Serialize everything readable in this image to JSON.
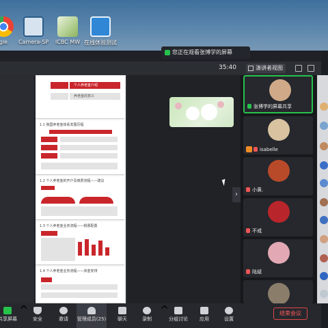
{
  "desktop": {
    "icons": [
      {
        "label": "gle",
        "icon": "chrome-icon",
        "color": "#d9d9d9"
      },
      {
        "label": "Camera-SP",
        "icon": "camera-app-icon",
        "color": "#bcd3e8"
      },
      {
        "label": "ICBC MW",
        "icon": "icbc-app-icon",
        "color": "#9ac26b"
      },
      {
        "label": "在线体验测试",
        "icon": "online-test-icon",
        "color": "#3b8fd9"
      }
    ]
  },
  "meeting": {
    "notice": "您正在观看张博学的屏幕",
    "time": "35:40",
    "view_label": "演讲者视图",
    "slides": {
      "s1_item1": "个人养老金介绍",
      "s1_item2": "养老金的意义",
      "s2_title": "1.1 我国养老金体系发展历程",
      "s3_title": "1.2 个人养老金的开户及缴费流程——建议",
      "s4_title": "1.3 个人养老金业务流程——税惠配置",
      "s5_title": "1.4 个人养老金业务流程——资金安排"
    },
    "participants": [
      {
        "name": "张博学的屏幕共享",
        "face": "#cfa988",
        "active": true,
        "badge": false
      },
      {
        "name": "isabelle",
        "face": "#d8c2a0",
        "active": false,
        "badge": true
      },
      {
        "name": "小黄.",
        "face": "#b84a2a",
        "active": false,
        "badge": false
      },
      {
        "name": "不戒",
        "face": "#b8262b",
        "active": false,
        "badge": false
      },
      {
        "name": "陆斌",
        "face": "#e2a9b4",
        "active": false,
        "badge": false
      },
      {
        "name": "",
        "face": "#8a7d6a",
        "active": false,
        "badge": false
      }
    ],
    "toolbar": [
      {
        "label": "共享屏幕",
        "icon": "share-screen-icon"
      },
      {
        "label": "安全",
        "icon": "security-icon"
      },
      {
        "label": "邀请",
        "icon": "invite-icon"
      },
      {
        "label": "管理成员(25)",
        "icon": "participants-icon"
      },
      {
        "label": "聊天",
        "icon": "chat-icon"
      },
      {
        "label": "录制",
        "icon": "record-icon"
      },
      {
        "label": "分组讨论",
        "icon": "breakout-icon"
      },
      {
        "label": "应用",
        "icon": "apps-icon"
      },
      {
        "label": "设置",
        "icon": "settings-icon"
      }
    ],
    "end_meeting": "结束会议"
  }
}
